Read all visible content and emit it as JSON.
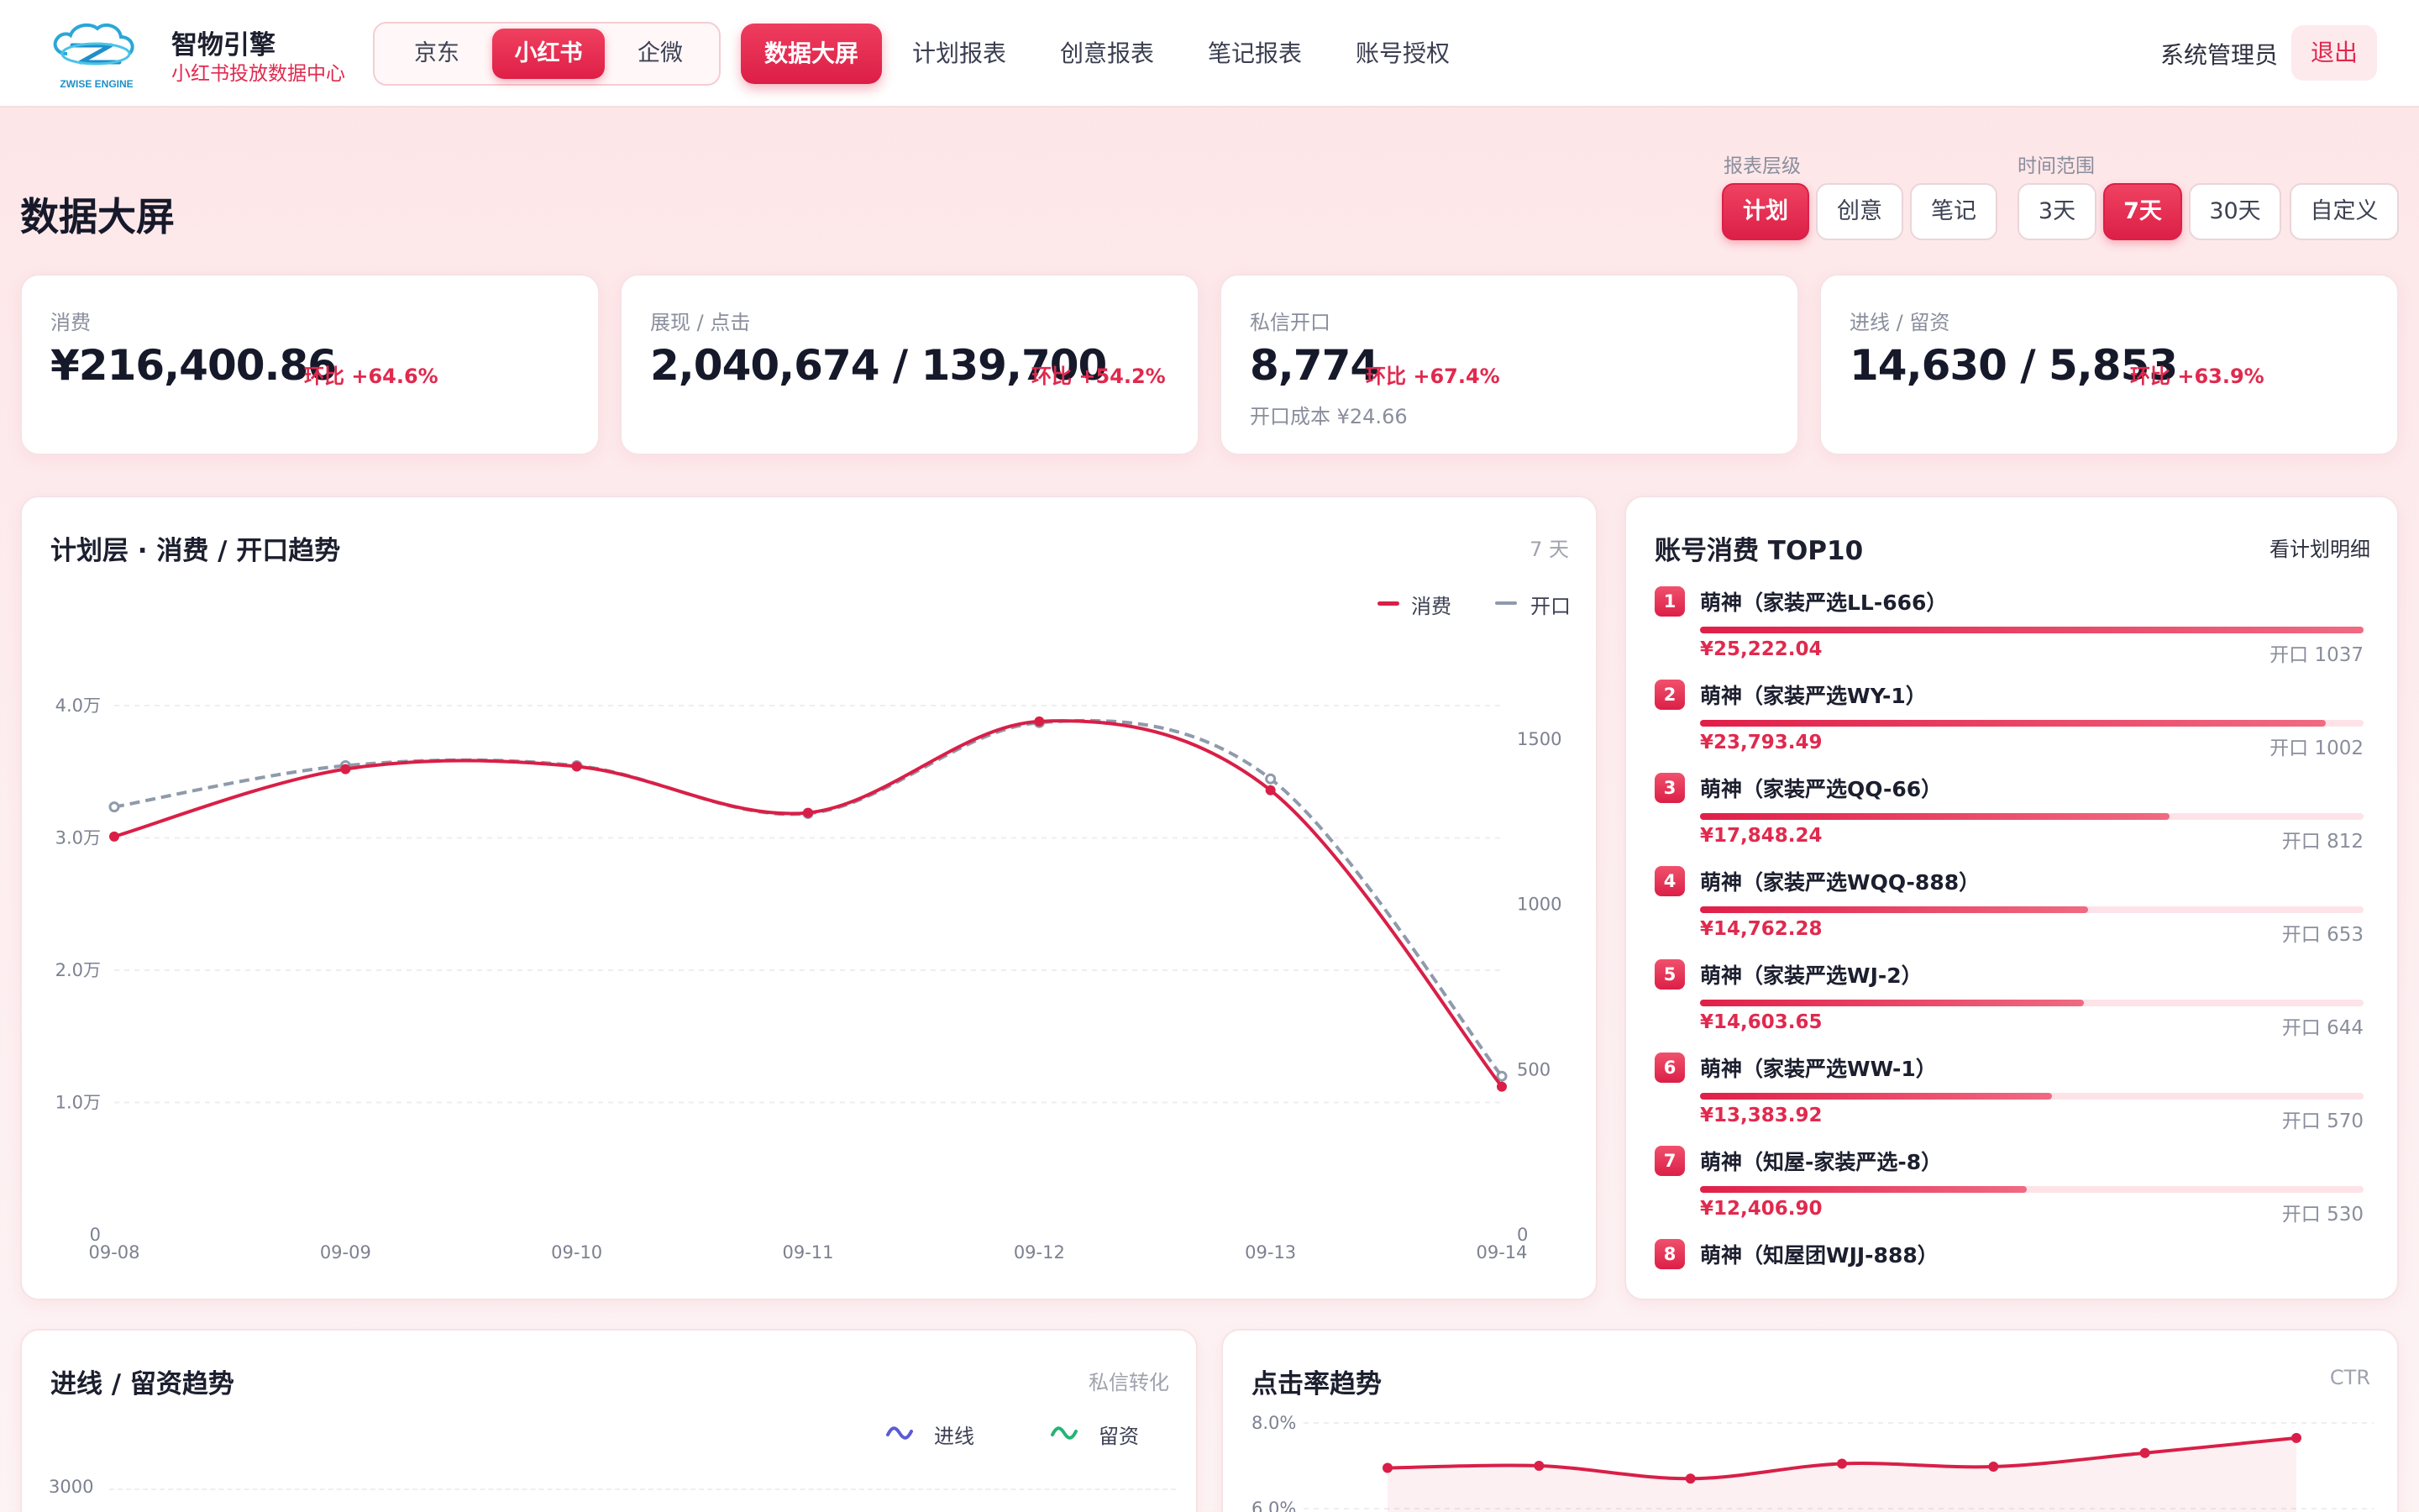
{
  "header": {
    "brand_title": "智物引擎",
    "brand_subtitle": "小红书投放数据中心",
    "logo_text": "ZWISE ENGINE",
    "platforms": [
      "京东",
      "小红书",
      "企微"
    ],
    "active_platform": "小红书",
    "nav": [
      "数据大屏",
      "计划报表",
      "创意报表",
      "笔记报表",
      "账号授权"
    ],
    "active_nav": "数据大屏",
    "user": "系统管理员",
    "logout": "退出"
  },
  "page": {
    "title": "数据大屏",
    "level_label": "报表层级",
    "levels": [
      "计划",
      "创意",
      "笔记"
    ],
    "active_level": "计划",
    "range_label": "时间范围",
    "ranges": [
      "3天",
      "7天",
      "30天",
      "自定义"
    ],
    "active_range": "7天"
  },
  "kpis": [
    {
      "label": "消费",
      "value": "¥216,400.86",
      "delta": "环比 +64.6%"
    },
    {
      "label": "展现 / 点击",
      "value": "2,040,674 / 139,700",
      "delta": "环比 +54.2%"
    },
    {
      "label": "私信开口",
      "value": "8,774",
      "delta": "环比 +67.4%",
      "foot": "开口成本 ¥24.66"
    },
    {
      "label": "进线 / 留资",
      "value": "14,630 / 5,853",
      "delta": "环比 +63.9%"
    }
  ],
  "trend_panel": {
    "title": "计划层 · 消费 / 开口趋势",
    "tag": "7 天",
    "legend": [
      "消费",
      "开口"
    ]
  },
  "top10": {
    "title": "账号消费 TOP10",
    "link": "看计划明细",
    "items": [
      {
        "rank": "1",
        "name": "萌神（家装严选LL-666）",
        "spend": "¥25,222.04",
        "open": "开口 1037",
        "ratio": 1.0
      },
      {
        "rank": "2",
        "name": "萌神（家装严选WY-1）",
        "spend": "¥23,793.49",
        "open": "开口 1002",
        "ratio": 0.943
      },
      {
        "rank": "3",
        "name": "萌神（家装严选QQ-66）",
        "spend": "¥17,848.24",
        "open": "开口 812",
        "ratio": 0.708
      },
      {
        "rank": "4",
        "name": "萌神（家装严选WQQ-888）",
        "spend": "¥14,762.28",
        "open": "开口 653",
        "ratio": 0.585
      },
      {
        "rank": "5",
        "name": "萌神（家装严选WJ-2）",
        "spend": "¥14,603.65",
        "open": "开口 644",
        "ratio": 0.579
      },
      {
        "rank": "6",
        "name": "萌神（家装严选WW-1）",
        "spend": "¥13,383.92",
        "open": "开口 570",
        "ratio": 0.531
      },
      {
        "rank": "7",
        "name": "萌神（知屋-家装严选-8）",
        "spend": "¥12,406.90",
        "open": "开口 530",
        "ratio": 0.492
      },
      {
        "rank": "8",
        "name": "萌神（知屋团WJJ-888）",
        "spend": "",
        "open": "",
        "ratio": 0
      }
    ]
  },
  "leads_panel": {
    "title": "进线 / 留资趋势",
    "tag": "私信转化",
    "legend": [
      "进线",
      "留资"
    ],
    "first_tick": "3000"
  },
  "ctr_panel": {
    "title": "点击率趋势",
    "tag": "CTR",
    "ticks": [
      "8.0%",
      "6.0%"
    ]
  },
  "colors": {
    "accent": "#e1294e",
    "spend_line": "#d91f47",
    "open_line": "#8f9aab",
    "leads_line": "#5b5bd6",
    "retain_line": "#22b573"
  },
  "chart_data": [
    {
      "type": "line",
      "title": "计划层 · 消费 / 开口趋势",
      "x": [
        "09-08",
        "09-09",
        "09-10",
        "09-11",
        "09-12",
        "09-13",
        "09-14"
      ],
      "y_ticks_left": [
        "0",
        "1.0万",
        "2.0万",
        "3.0万",
        "4.0万"
      ],
      "y_ticks_right": [
        "0",
        "500",
        "1000",
        "1500"
      ],
      "ylim_left": [
        0,
        40000
      ],
      "ylim_right": [
        0,
        1500
      ],
      "series": [
        {
          "name": "消费",
          "axis": "left",
          "values": [
            30100,
            35200,
            35400,
            31900,
            38800,
            33600,
            11200
          ]
        },
        {
          "name": "开口",
          "axis": "right",
          "values": [
            1295,
            1420,
            1420,
            1275,
            1550,
            1380,
            480
          ]
        }
      ],
      "grid": true,
      "legend": "top-right"
    },
    {
      "type": "line",
      "title": "点击率趋势",
      "y_ticks": [
        "8.0%",
        "6.0%"
      ],
      "series": [
        {
          "values": [
            6.95,
            7.0,
            6.7,
            7.05,
            6.98,
            7.3,
            7.65
          ]
        }
      ]
    }
  ]
}
